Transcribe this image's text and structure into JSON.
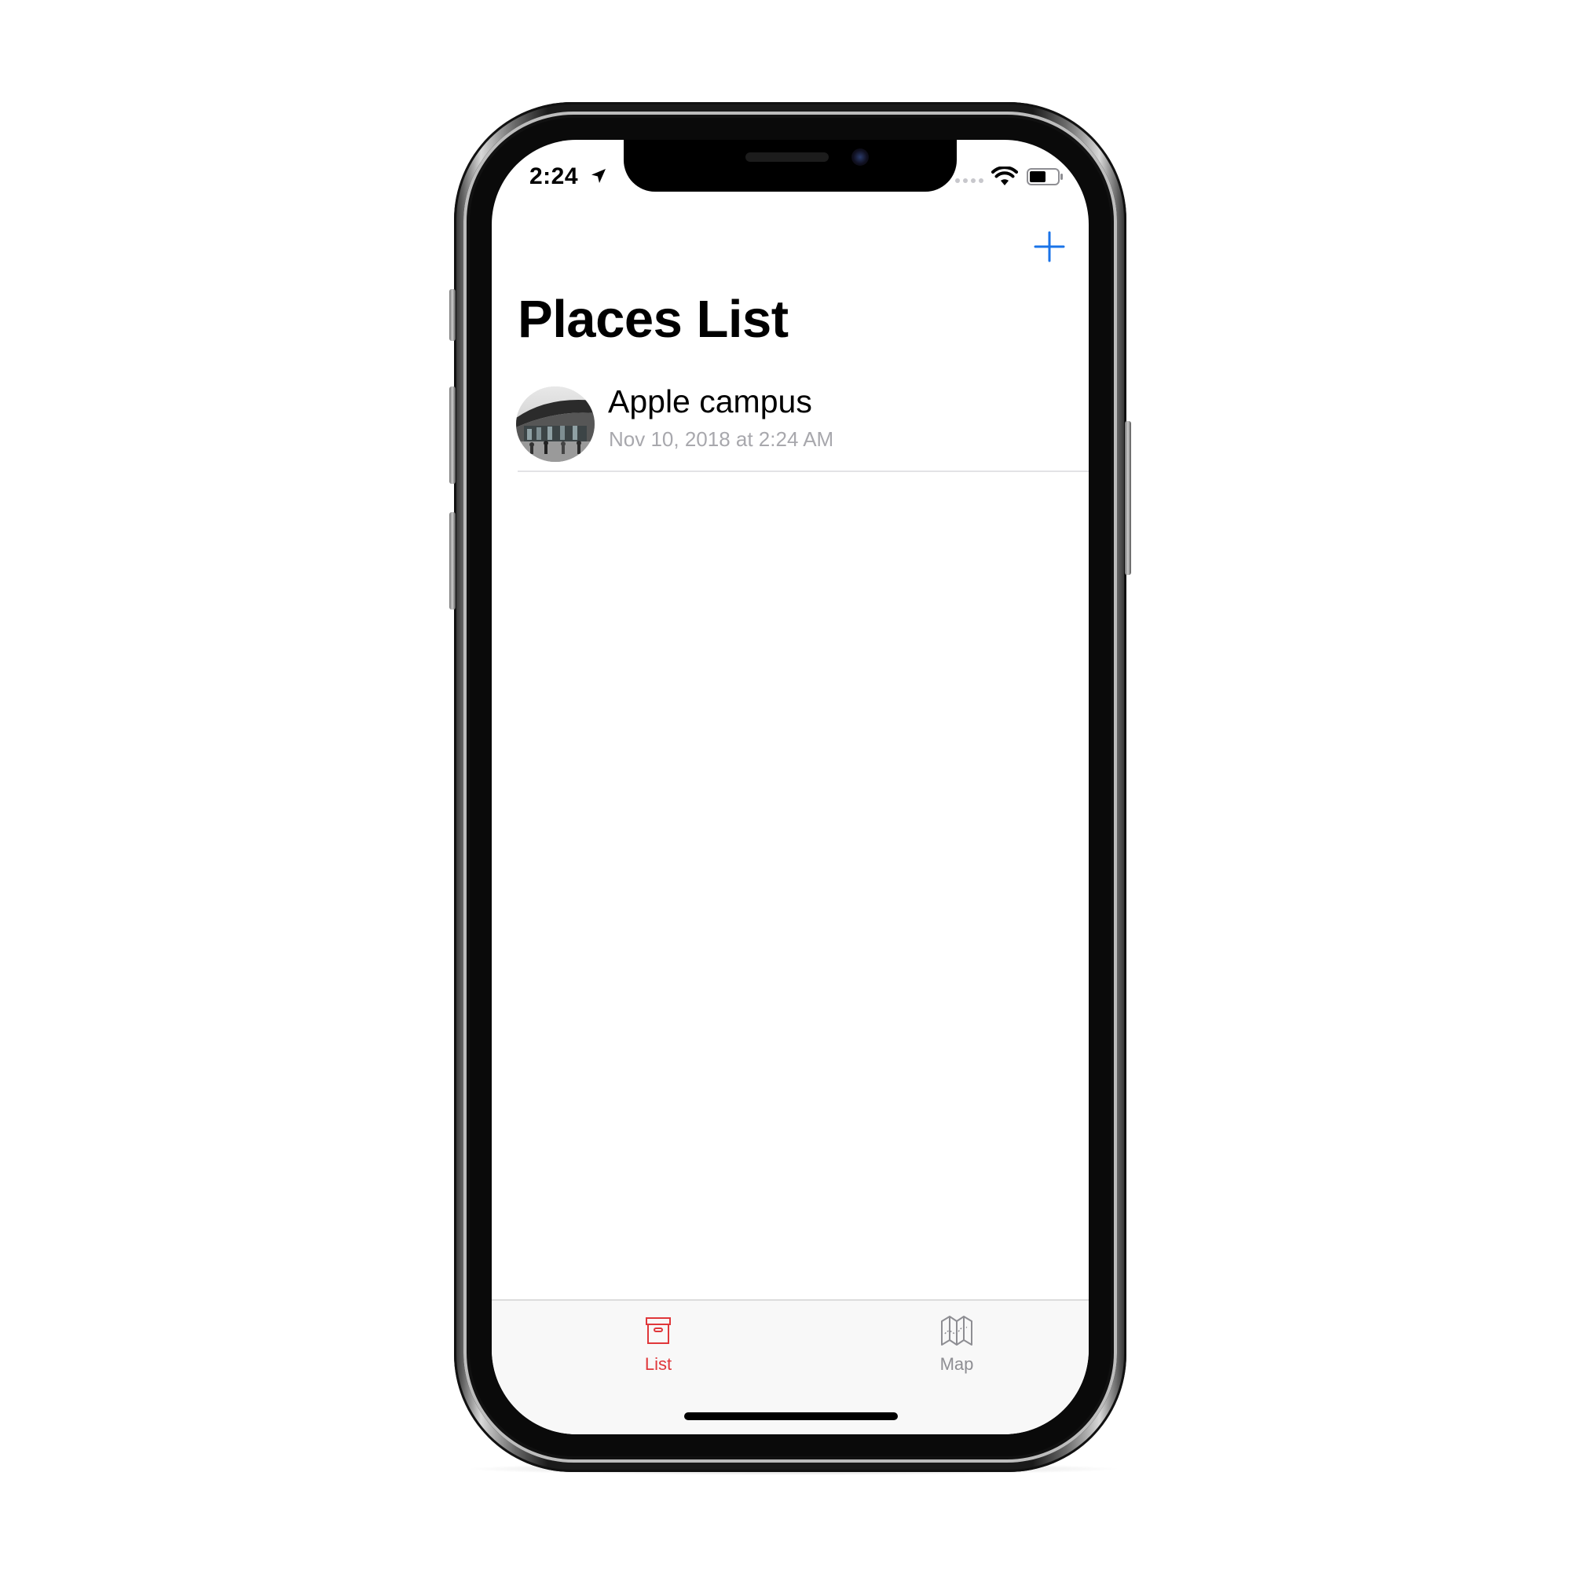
{
  "status_bar": {
    "time": "2:24"
  },
  "nav": {
    "title": "Places List"
  },
  "places": [
    {
      "title": "Apple campus",
      "subtitle": "Nov 10, 2018 at 2:24 AM"
    }
  ],
  "tab_bar": {
    "tabs": [
      {
        "label": "List",
        "icon": "archive-box-icon",
        "selected": true
      },
      {
        "label": "Map",
        "icon": "map-icon",
        "selected": false
      }
    ]
  },
  "colors": {
    "accent_blue": "#1a73e8",
    "selected_tab": "#e0373a",
    "unselected_tab": "#8e8e93",
    "subtitle_gray": "#a8a8ad"
  }
}
